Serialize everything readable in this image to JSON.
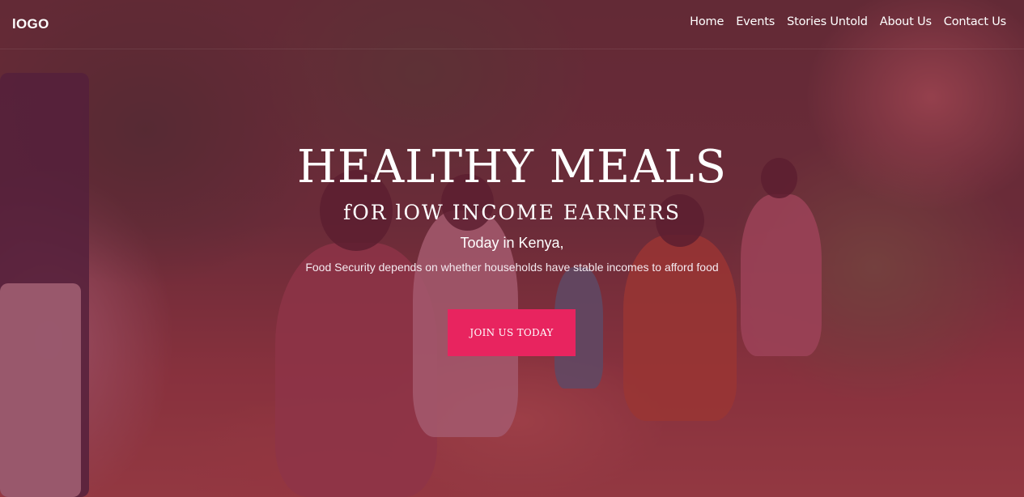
{
  "navbar": {
    "logo": "lOGO",
    "links": [
      "Home",
      "Events",
      "Stories Untold",
      "About Us",
      "Contact Us"
    ]
  },
  "hero": {
    "headline": "HEALTHY MEALS",
    "subheadline": "fOR lOW INCOME EARNERS",
    "tagline": "Today in Kenya,",
    "description": "Food Security depends on whether households have stable incomes to afford food",
    "cta_label": "JOIN US TODAY"
  },
  "colors": {
    "overlay": "#781e46",
    "cta": "#e8245f",
    "text": "#ffffff"
  }
}
